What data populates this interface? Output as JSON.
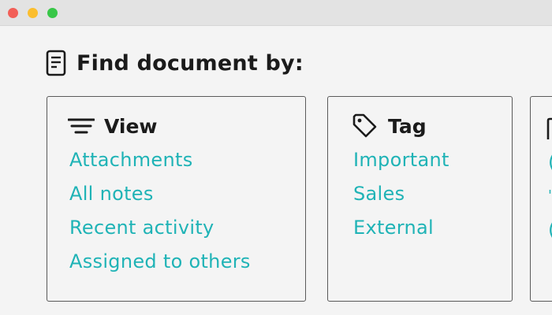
{
  "window": {
    "controls": [
      "close",
      "minimize",
      "maximize"
    ]
  },
  "heading": {
    "icon": "document-icon",
    "title": "Find document by:"
  },
  "cards": [
    {
      "icon": "filter-lines-icon",
      "title": "View",
      "links": [
        "Attachments",
        "All notes",
        "Recent activity",
        "Assigned to others"
      ]
    },
    {
      "icon": "tag-icon",
      "title": "Tag",
      "links": [
        "Important",
        "Sales",
        "External"
      ]
    }
  ],
  "colors": {
    "link": "#1fb3b6",
    "heading": "#1b1b1b",
    "background": "#f4f4f4",
    "titlebar": "#e3e3e3",
    "close": "#f25f58",
    "minimize": "#fbbe2e",
    "maximize": "#38c748"
  }
}
